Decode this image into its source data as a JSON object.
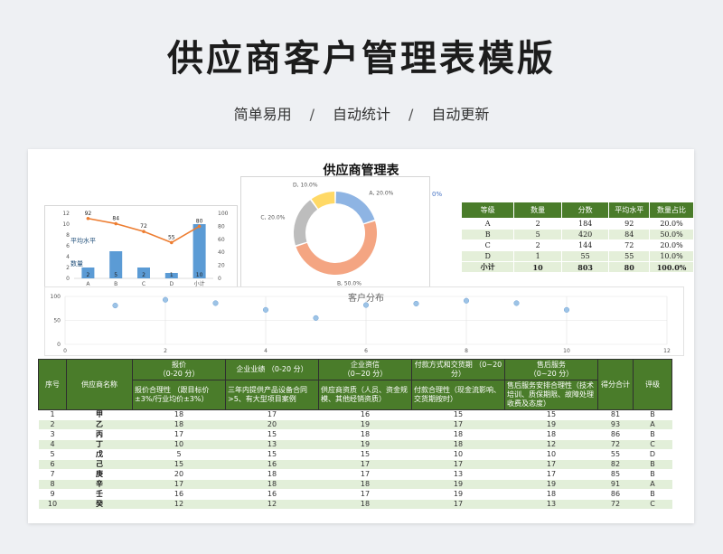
{
  "page_title": "供应商客户管理表模版",
  "tagline": [
    "简单易用",
    "自动统计",
    "自动更新"
  ],
  "tagline_sep": "/",
  "sheet_title": "供应商管理表",
  "charts": {
    "combo": {
      "legend_line": "平均水平",
      "legend_bar": "数量",
      "categories": [
        "A",
        "B",
        "C",
        "D",
        "小计"
      ],
      "bar_values": [
        2,
        5,
        2,
        1,
        10
      ],
      "line_values": [
        92,
        84,
        72,
        55,
        80
      ],
      "left_axis": [
        0,
        2,
        4,
        6,
        8,
        10,
        12
      ],
      "right_axis": [
        0,
        20,
        40,
        60,
        80,
        100
      ],
      "left_max": 12,
      "right_max": 100
    },
    "donut": {
      "slices": [
        {
          "label": "A, 20.0%",
          "value": 20,
          "color": "#8eb4e3"
        },
        {
          "label": "B, 50.0%",
          "value": 50,
          "color": "#f4a582"
        },
        {
          "label": "C, 20.0%",
          "value": 20,
          "color": "#bdbdbd"
        },
        {
          "label": "D, 10.0%",
          "value": 10,
          "color": "#ffd966"
        }
      ],
      "overflow_label": "0%"
    },
    "scatter": {
      "title": "客户分布",
      "x": [
        1,
        2,
        3,
        4,
        5,
        6,
        7,
        8,
        9,
        10
      ],
      "y": [
        81,
        93,
        86,
        72,
        55,
        82,
        85,
        91,
        86,
        72
      ],
      "x_ticks": [
        0,
        2,
        4,
        6,
        8,
        10,
        12
      ],
      "y_ticks": [
        0,
        50,
        100
      ],
      "xlim": [
        0,
        12
      ],
      "ylim": [
        0,
        100
      ]
    }
  },
  "stats": {
    "headers": [
      "等级",
      "数量",
      "分数",
      "平均水平",
      "数量占比"
    ],
    "rows": [
      [
        "A",
        "2",
        "184",
        "92",
        "20.0%"
      ],
      [
        "B",
        "5",
        "420",
        "84",
        "50.0%"
      ],
      [
        "C",
        "2",
        "144",
        "72",
        "20.0%"
      ],
      [
        "D",
        "1",
        "55",
        "55",
        "10.0%"
      ]
    ],
    "total": [
      "小计",
      "10",
      "803",
      "80",
      "100.0%"
    ]
  },
  "table": {
    "h_no": "序号",
    "h_name": "供应商名称",
    "h_c1": "报价\n（0-20 分）",
    "h_c2": "企业业绩 （0-20 分）",
    "h_c3": "企业资信\n（0~20 分）",
    "h_c4": "付款方式和交货期 （0~20 分）",
    "h_c5": "售后服务\n（0~20 分）",
    "h_total": "得分合计",
    "h_grade": "评级",
    "s_c1": "报价合理性 （跟目标价±3%/行业均价±3%）",
    "s_c2": "三年内提供产品设备合同 >5、有大型项目案例",
    "s_c3": "供应商资质（人员、资金规模、其他经销资质）",
    "s_c4": "付款合理性（现金流影响、交货期按时）",
    "s_c5": "售后服务安排合理性（技术培训、质保期限、故障处理收费及态度）",
    "rows": [
      [
        "1",
        "甲",
        "18",
        "17",
        "16",
        "15",
        "15",
        "81",
        "B"
      ],
      [
        "2",
        "乙",
        "18",
        "20",
        "19",
        "17",
        "19",
        "93",
        "A"
      ],
      [
        "3",
        "丙",
        "17",
        "15",
        "18",
        "18",
        "18",
        "86",
        "B"
      ],
      [
        "4",
        "丁",
        "10",
        "13",
        "19",
        "18",
        "12",
        "72",
        "C"
      ],
      [
        "5",
        "戊",
        "5",
        "15",
        "15",
        "10",
        "10",
        "55",
        "D"
      ],
      [
        "6",
        "己",
        "15",
        "16",
        "17",
        "17",
        "17",
        "82",
        "B"
      ],
      [
        "7",
        "庚",
        "20",
        "18",
        "17",
        "13",
        "17",
        "85",
        "B"
      ],
      [
        "8",
        "辛",
        "17",
        "18",
        "18",
        "19",
        "19",
        "91",
        "A"
      ],
      [
        "9",
        "壬",
        "16",
        "16",
        "17",
        "19",
        "18",
        "86",
        "B"
      ],
      [
        "10",
        "癸",
        "12",
        "12",
        "18",
        "17",
        "13",
        "72",
        "C"
      ]
    ]
  },
  "colors": {
    "header_green": "#4a7c2a",
    "row_green": "#e2efd9",
    "bar_blue": "#5b9bd5",
    "line_orange": "#ed7d31",
    "point_blue": "#9dc3e6"
  }
}
